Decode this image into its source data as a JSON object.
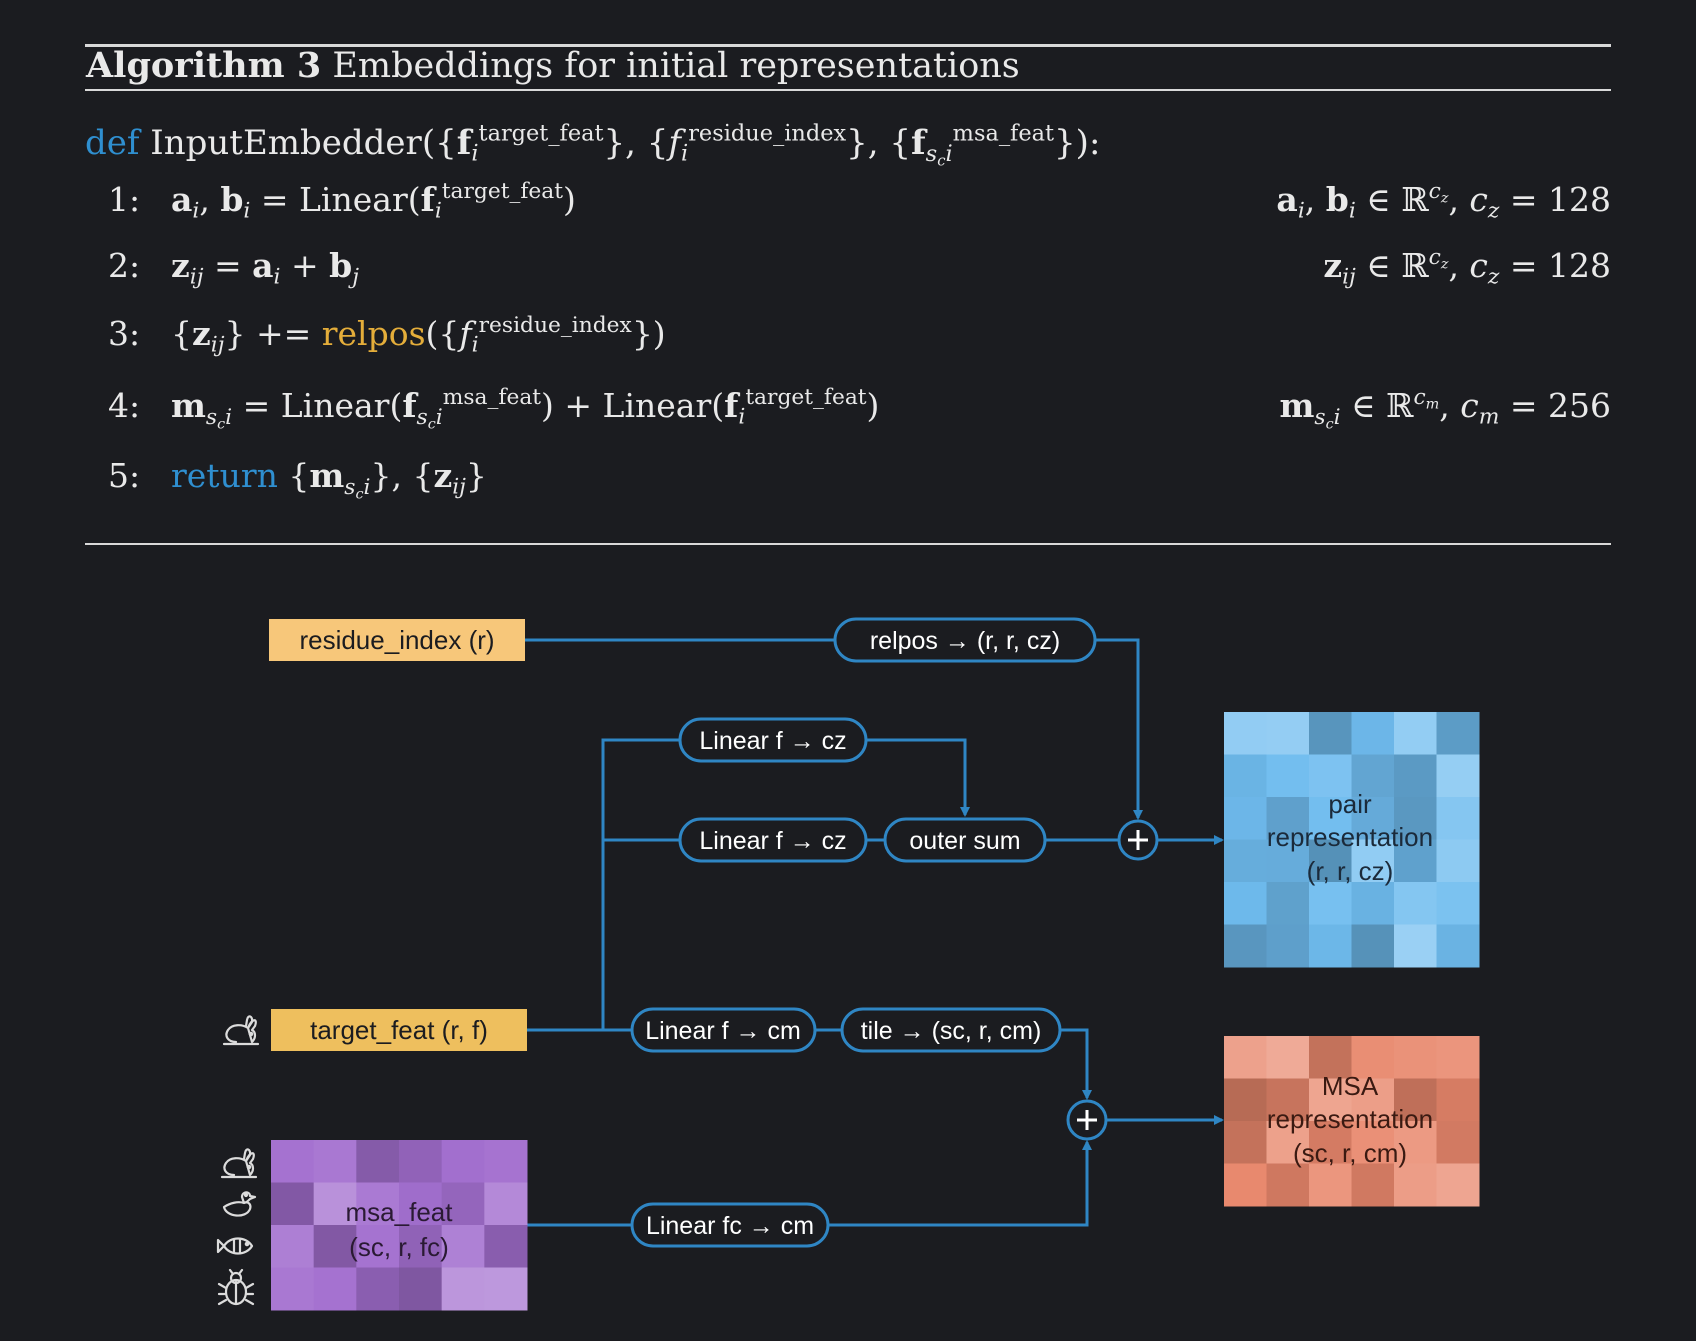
{
  "algorithm": {
    "label": "Algorithm 3",
    "title": "Embeddings for initial representations",
    "def_keyword": "def",
    "def_name": "InputEmbedder",
    "def_args": [
      "target_feat",
      "residue_index",
      "msa_feat"
    ],
    "lines": [
      {
        "num": "1:",
        "annotation": "c_z = 128"
      },
      {
        "num": "2:",
        "annotation": "c_z = 128"
      },
      {
        "num": "3:",
        "func": "relpos"
      },
      {
        "num": "4:",
        "annotation": "c_m = 256"
      },
      {
        "num": "5:",
        "keyword": "return"
      }
    ]
  },
  "diagram": {
    "inputs": {
      "residue_index": "residue_index (r)",
      "target_feat": "target_feat (r, f)",
      "msa_feat": "msa_feat",
      "msa_feat_shape": "(sc, r, fc)"
    },
    "ops": {
      "relpos": "relpos → (r, r, cz)",
      "linear_a": "Linear f → cz",
      "linear_b": "Linear f → cz",
      "outer_sum": "outer sum",
      "linear_m": "Linear f → cm",
      "tile": "tile → (sc, r, cm)",
      "linear_msa": "Linear fc → cm"
    },
    "outputs": {
      "pair": [
        "pair",
        "representation",
        "(r, r, cz)"
      ],
      "msa": [
        "MSA",
        "representation",
        "(sc, r, cm)"
      ]
    },
    "icons": [
      "rabbit-icon",
      "duck-icon",
      "fish-icon",
      "bug-icon"
    ],
    "colors": {
      "line": "#2f86c4",
      "input_orange": "#f3c46a",
      "pair_blue": "#6fbcef",
      "msa_red": "#e8876c",
      "msa_purple": "#a36fcf"
    }
  }
}
